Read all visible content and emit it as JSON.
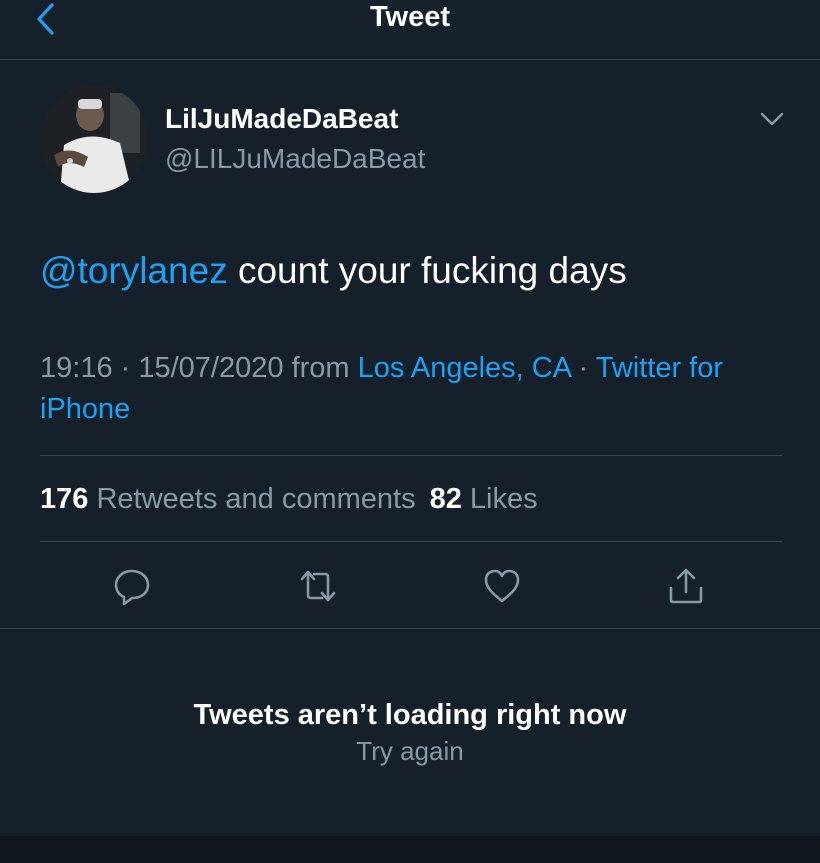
{
  "header": {
    "title": "Tweet",
    "back_icon": "chevron-left-icon"
  },
  "tweet": {
    "author": {
      "display_name": "LilJuMadeDaBeat",
      "handle": "@LILJuMadeDaBeat"
    },
    "text": {
      "mention": "@torylanez",
      "body": " count your fucking days"
    },
    "meta": {
      "time": "19:16",
      "sep1": " · ",
      "date": "15/07/2020",
      "from": " from ",
      "location": "Los Angeles, CA",
      "sep2": " · ",
      "source": "Twitter for iPhone"
    },
    "stats": {
      "retweets_count": "176",
      "retweets_label": " Retweets and comments",
      "likes_count": "82",
      "likes_label": " Likes"
    },
    "actions": [
      "reply-icon",
      "retweet-icon",
      "like-icon",
      "share-icon"
    ]
  },
  "replies": {
    "error_title": "Tweets aren’t loading right now",
    "retry_label": "Try again"
  },
  "colors": {
    "background": "#15202b",
    "accent": "#1da1f2",
    "muted": "#8899a6",
    "divider": "#38444d"
  }
}
